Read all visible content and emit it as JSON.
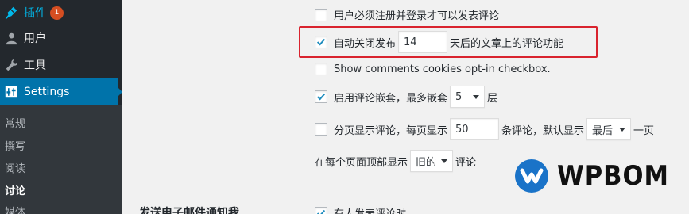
{
  "sidebar": {
    "plugins": {
      "label": "插件",
      "badge": "1",
      "icon": "plugin-icon"
    },
    "users": {
      "label": "用户",
      "icon": "user-icon"
    },
    "tools": {
      "label": "工具",
      "icon": "wrench-icon"
    },
    "settings": {
      "label": "Settings",
      "icon": "settings-icon"
    },
    "submenu": [
      {
        "label": "常规"
      },
      {
        "label": "撰写"
      },
      {
        "label": "阅读"
      },
      {
        "label": "讨论",
        "current": true
      },
      {
        "label": "媒体"
      }
    ]
  },
  "discussion": {
    "require_registration": {
      "label": "用户必须注册并登录才可以发表评论",
      "checked": false
    },
    "auto_close": {
      "label_before": "自动关闭发布",
      "value": "14",
      "label_after": "天后的文章上的评论功能",
      "checked": true
    },
    "cookies_optin": {
      "label": "Show comments cookies opt-in checkbox.",
      "checked": false
    },
    "threaded": {
      "label_before": "启用评论嵌套，最多嵌套",
      "value": "5",
      "label_after": "层",
      "checked": true
    },
    "paged": {
      "label_before": "分页显示评论，每页显示",
      "value": "50",
      "label_middle": "条评论，默认显示",
      "select": "最后",
      "label_after": "一页",
      "checked": false
    },
    "order": {
      "label_before": "在每个页面顶部显示",
      "select": "旧的",
      "label_after": "评论"
    },
    "email_section": {
      "label": "发送电子邮件通知我"
    },
    "anyone_posts": {
      "label": "有人发表评论时",
      "checked": true
    }
  },
  "watermark": {
    "text": "WPBOM",
    "color": "#1a73c8"
  },
  "colors": {
    "sidebar": "#23282d",
    "submenu": "#32373c",
    "active": "#0073aa",
    "highlight": "#d9232e"
  }
}
